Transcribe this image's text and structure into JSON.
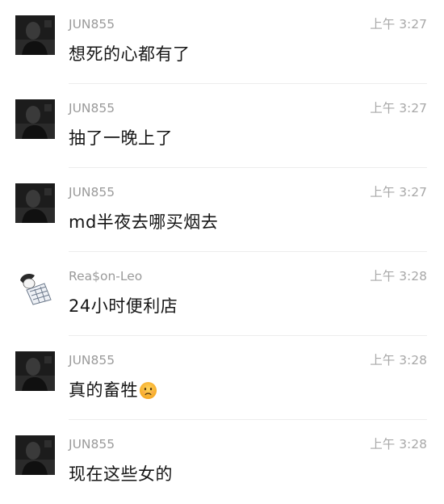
{
  "messages": [
    {
      "sender": "JUN855",
      "time": "上午 3:27",
      "text": "想死的心都有了",
      "avatar": "dark-portrait-avatar",
      "emoji": ""
    },
    {
      "sender": "JUN855",
      "time": "上午 3:27",
      "text": "抽了一晚上了",
      "avatar": "dark-portrait-avatar",
      "emoji": ""
    },
    {
      "sender": "JUN855",
      "time": "上午 3:27",
      "text": "md半夜去哪买烟去",
      "avatar": "dark-portrait-avatar",
      "emoji": ""
    },
    {
      "sender": "Rea$on-Leo",
      "time": "上午 3:28",
      "text": "24小时便利店",
      "avatar": "sketch-character-avatar",
      "emoji": ""
    },
    {
      "sender": "JUN855",
      "time": "上午 3:28",
      "text": "真的畜牲",
      "avatar": "dark-portrait-avatar",
      "emoji": "frowning-face-emoji"
    },
    {
      "sender": "JUN855",
      "time": "上午 3:28",
      "text": "现在这些女的",
      "avatar": "dark-portrait-avatar",
      "emoji": ""
    }
  ],
  "colors": {
    "sender": "#9a9a9a",
    "time": "#a8a8a8",
    "text": "#161616",
    "divider": "#ececec",
    "background": "#ffffff"
  }
}
